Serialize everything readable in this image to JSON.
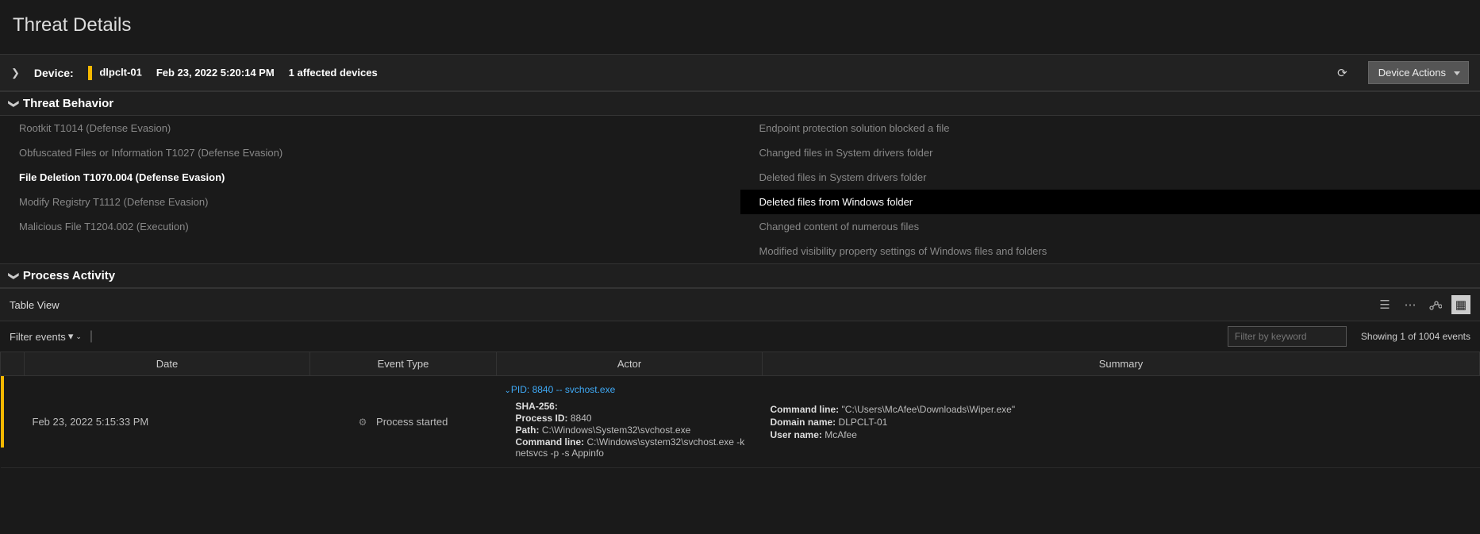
{
  "page_title": "Threat Details",
  "device_bar": {
    "device_label": "Device:",
    "device_name": "dlpclt-01",
    "timestamp": "Feb 23, 2022 5:20:14 PM",
    "affected": "1 affected devices",
    "actions_btn": "Device Actions"
  },
  "sections": {
    "threat_behavior": "Threat Behavior",
    "process_activity": "Process Activity"
  },
  "behavior_left": [
    {
      "label": "Rootkit T1014 (Defense Evasion)",
      "active": false
    },
    {
      "label": "Obfuscated Files or Information T1027 (Defense Evasion)",
      "active": false
    },
    {
      "label": "File Deletion T1070.004 (Defense Evasion)",
      "active": true
    },
    {
      "label": "Modify Registry T1112 (Defense Evasion)",
      "active": false
    },
    {
      "label": "Malicious File T1204.002 (Execution)",
      "active": false
    }
  ],
  "behavior_right": [
    {
      "label": "Endpoint protection solution blocked a file",
      "active": false
    },
    {
      "label": "Changed files in System drivers folder",
      "active": false
    },
    {
      "label": "Deleted files in System drivers folder",
      "active": false
    },
    {
      "label": "Deleted files from Windows folder",
      "active": true
    },
    {
      "label": "Changed content of numerous files",
      "active": false
    },
    {
      "label": "Modified visibility property settings of Windows files and folders",
      "active": false
    }
  ],
  "table_view": {
    "label": "Table View",
    "filter_label": "Filter events",
    "keyword_placeholder": "Filter by keyword",
    "showing": "Showing 1 of 1004 events",
    "headers": {
      "date": "Date",
      "etype": "Event Type",
      "actor": "Actor",
      "summary": "Summary"
    }
  },
  "row": {
    "date": "Feb 23, 2022 5:15:33 PM",
    "event_type": "Process started",
    "pid_label": "PID: 8840 -- svchost.exe",
    "actor": {
      "sha_label": "SHA-256:",
      "pid_label": "Process ID:",
      "pid_val": "8840",
      "path_label": "Path:",
      "path_val": "C:\\Windows\\System32\\svchost.exe",
      "cmd_label": "Command line:",
      "cmd_val": "C:\\Windows\\system32\\svchost.exe -k netsvcs -p -s Appinfo"
    },
    "summary": {
      "cmd_label": "Command line:",
      "cmd_val": "\"C:\\Users\\McAfee\\Downloads\\Wiper.exe\"",
      "dom_label": "Domain name:",
      "dom_val": "DLPCLT-01",
      "user_label": "User name:",
      "user_val": "McAfee"
    }
  }
}
